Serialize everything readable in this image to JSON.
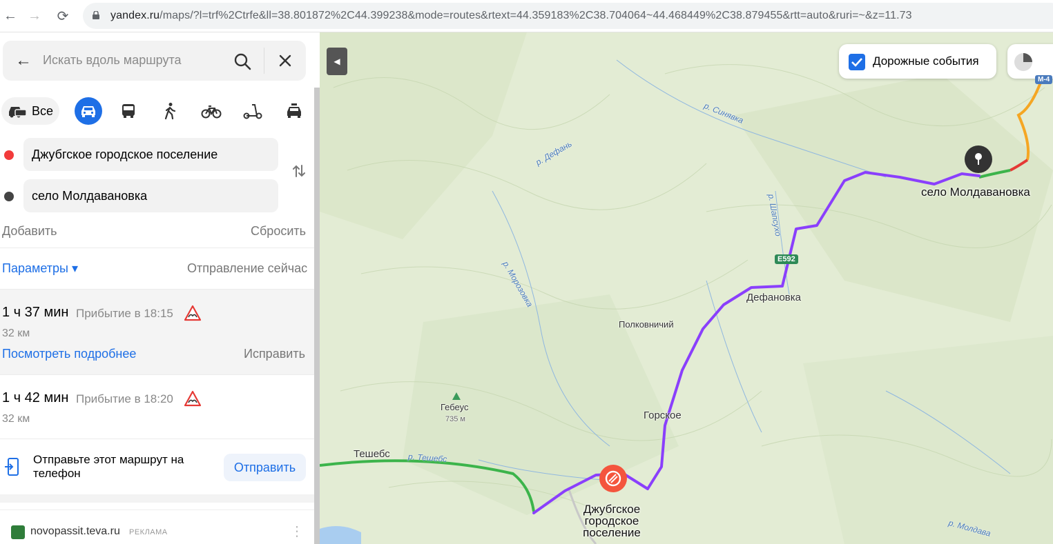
{
  "browser": {
    "url_host": "yandex.ru",
    "url_path": "/maps/?l=trf%2Ctrfe&ll=38.801872%2C44.399238&mode=routes&rtext=44.359183%2C38.704064~44.468449%2C38.879455&rtt=auto&ruri=~&z=11.73"
  },
  "sidebar": {
    "search_placeholder": "Искать вдоль маршрута",
    "modes": {
      "all_label": "Все"
    },
    "from_point": "Джубгское городское поселение",
    "to_point": "село Молдавановка",
    "add_label": "Добавить",
    "reset_label": "Сбросить",
    "params_label": "Параметры ▾",
    "depart_label": "Отправление сейчас",
    "routes": [
      {
        "time": "1 ч 37 мин",
        "arrival": "Прибытие в 18:15",
        "distance": "32 км",
        "details_label": "Посмотреть подробнее",
        "fix_label": "Исправить"
      },
      {
        "time": "1 ч 42 мин",
        "arrival": "Прибытие в 18:20",
        "distance": "32 км"
      }
    ],
    "send": {
      "text": "Отправьте этот маршрут на телефон",
      "button": "Отправить"
    },
    "ad": {
      "host": "novopassit.teva.ru",
      "tag": "РЕКЛАМА"
    }
  },
  "map": {
    "traffic_label": "Дорожные события",
    "places": {
      "moldavanovka": "село Молдавановка",
      "defanovka": "Дефановка",
      "polkovnichiy": "Полковничий",
      "gorskoe": "Горское",
      "teshebs": "Тешебс",
      "gebeus": "Гебеус",
      "gebeus_elev": "735 м",
      "dzhubga": "Джубгское городское поселение"
    },
    "rivers": {
      "sinyavka": "р. Синявка",
      "defan": "р. Дефань",
      "shapsuho": "р. Шапсухо",
      "morozovka": "р. Морозовка",
      "teshebs": "р. Тешебс",
      "moldav": "р. Молдава"
    },
    "roads": {
      "e592": "E592",
      "m4": "М-4"
    },
    "colors": {
      "route": "#8a3ffc",
      "alt_route": "#3cb44b",
      "accent": "#1e6fe6",
      "start": "#f4553d"
    }
  }
}
